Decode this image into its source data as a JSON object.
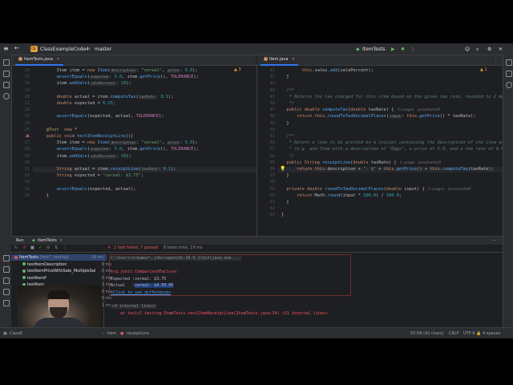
{
  "toolbar": {
    "project_badge": "CE",
    "project": "ClassExampleCode4",
    "branch": "master",
    "run_config": "ItemTests"
  },
  "tabs": {
    "left": "ItemTests.java",
    "right": "Item.java"
  },
  "left_editor": {
    "warning_count": "3",
    "lines": [
      {
        "n": "16",
        "text": "Item item = new Item(description: \"cereal\", price: 5.0);"
      },
      {
        "n": "17",
        "text": "assertEquals(expected: 5.0, item.getPrice(), TOLERANCE);"
      },
      {
        "n": "18",
        "text": "item.addSale(salePercent: 10);"
      },
      {
        "n": "19",
        "text": ""
      },
      {
        "n": "20",
        "text": "double actual = item.computeTax(taxRate: 0.1);"
      },
      {
        "n": "21",
        "text": "double expected = 0.25;"
      },
      {
        "n": "22",
        "text": ""
      },
      {
        "n": "23",
        "text": "assertEquals(expected, actual, TOLERANCE);"
      },
      {
        "n": "24",
        "text": ""
      },
      {
        "n": "25",
        "text": "@Test  new *"
      },
      {
        "n": "26",
        "text": "public void testItemReceiptLine(){"
      },
      {
        "n": "27",
        "text": "Item item = new Item(description: \"cereal\", price: 5.0);"
      },
      {
        "n": "28",
        "text": "assertEquals(expected: 5.0, item.getPrice(), TOLERANCE);"
      },
      {
        "n": "29",
        "text": "item.addSale(salePercent: 10);"
      },
      {
        "n": "30",
        "text": ""
      },
      {
        "n": "31",
        "text": "String actual = item.receiptLine(taxRate: 0.1);"
      },
      {
        "n": "32",
        "text": "String expected = \"cereal: $3.75\";"
      },
      {
        "n": "33",
        "text": ""
      },
      {
        "n": "34",
        "text": "assertEquals(expected, actual);"
      },
      {
        "n": "35",
        "text": "}"
      }
    ]
  },
  "right_editor": {
    "warning_count": "1",
    "lines": [
      {
        "n": "41",
        "text": "this.sales.add(salePercent);"
      },
      {
        "n": "42",
        "text": "}"
      },
      {
        "n": "43",
        "text": ""
      },
      {
        "n": "44",
        "text": "/**"
      },
      {
        "n": "45",
        "text": " * Returns the tax charged for this item based on the given tax rate, rounded to 2 deci"
      },
      {
        "n": "46",
        "text": " */"
      },
      {
        "n": "47",
        "text": "public double computeTax(double taxRate) {   3 usages   jessehartloff"
      },
      {
        "n": "48",
        "text": "return this.roundToTwoDecimalPlaces(input: this.getPrice() * taxRate);"
      },
      {
        "n": "49",
        "text": "}"
      },
      {
        "n": "50",
        "text": ""
      },
      {
        "n": "51",
        "text": "/**"
      },
      {
        "n": "52",
        "text": " * Return a line to be printed on a receipt containing the description of the item and i"
      },
      {
        "n": "53",
        "text": " * (e.g. and Item with a description of \"Eggs\", a price of 5.0, and a tax rate of 0.05 s"
      },
      {
        "n": "54",
        "text": " */"
      },
      {
        "n": "55",
        "text": "public String receiptLine(double taxRate) {   1 usage   jessehartloff"
      },
      {
        "n": "56",
        "text": "return this.description + \": $\" + this.getPrice() + this.computeTax(taxRate);"
      },
      {
        "n": "57",
        "text": "}"
      },
      {
        "n": "58",
        "text": ""
      },
      {
        "n": "59",
        "text": "private double roundToTwoDecimalPlaces(double input) {   2 usages   jessehartloff"
      },
      {
        "n": "60",
        "text": "return Math.round(input * 100.0) / 100.0;"
      },
      {
        "n": "61",
        "text": "}"
      },
      {
        "n": "62",
        "text": ""
      },
      {
        "n": "63",
        "text": "}"
      }
    ]
  },
  "run_panel": {
    "tab_run": "Run",
    "tab_config": "ItemTests",
    "summary": "1 test failed, 7 passed",
    "summary_detail": "8 tests total, 19 ms",
    "tree": [
      {
        "label": "ItemTests",
        "detail": "(test7_testing)",
        "time": "19 ms",
        "status": "fail"
      },
      {
        "label": "testItemDescription",
        "time": "0 ms",
        "status": "pass"
      },
      {
        "label": "testItemPriceWithSale_MultipleSal",
        "time": "0 ms",
        "status": "pass"
      },
      {
        "label": "testItemP",
        "time": "0 ms",
        "status": "pass"
      },
      {
        "label": "testItem",
        "time": "1 ms",
        "status": "pass"
      },
      {
        "label": "testItem",
        "time": "0 ms",
        "status": "pass"
      },
      {
        "label": "testItemMultipleSales",
        "time": "0 ms",
        "status": "pass"
      },
      {
        "label": "testItem",
        "time": "1 ms",
        "status": "pass"
      }
    ],
    "console": [
      {
        "text": "C:\\Users\\hrmamar\\.jdks\\openjdk-20.0.1\\bin\\java.exe ...",
        "kind": "path"
      },
      {
        "text": "",
        "kind": "plain"
      },
      {
        "text": "org.junit.ComparisonFailure:",
        "kind": "err"
      },
      {
        "text": "Expected :cereal: $3.75",
        "kind": "plain"
      },
      {
        "text": "Actual   :cereal: $4.50.05",
        "kind": "actual"
      },
      {
        "text": "<Click to see difference>",
        "kind": "link"
      },
      {
        "text": "",
        "kind": "plain"
      },
      {
        "text": "<4 internal lines>",
        "kind": "internal"
      },
      {
        "text": "    at tools7 testing.ItemTests.testItemReceiptLine(ItemTests.java:34) <31 internal lines>",
        "kind": "err"
      }
    ]
  },
  "status_bar": {
    "breadcrumb_1": "ClassE",
    "breadcrumb_2": "item",
    "breadcrumb_3": "receiptLine",
    "position": "55:58 (42 chars)",
    "line_ending": "CRLF",
    "encoding": "UTF-8",
    "indent": "4 spaces"
  }
}
